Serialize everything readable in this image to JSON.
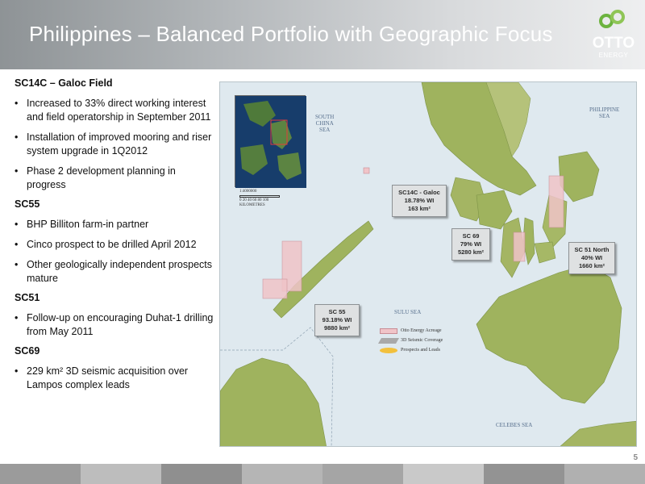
{
  "header": {
    "title": "Philippines – Balanced Portfolio with Geographic Focus",
    "logo_text": "OTTO",
    "logo_sub": "ENERGY",
    "logo_color": "#6cb33f"
  },
  "sections": [
    {
      "heading": "SC14C – Galoc Field",
      "bullets": [
        "Increased to 33% direct working interest and field operatorship in September 2011",
        "Installation of improved mooring and riser system upgrade in 1Q2012",
        "Phase 2 development planning in progress"
      ]
    },
    {
      "heading": "SC55",
      "bullets": [
        "BHP Billiton farm-in partner",
        "Cinco prospect to be drilled April 2012",
        "Other geologically independent prospects mature"
      ]
    },
    {
      "heading": "SC51",
      "bullets": [
        "Follow-up on encouraging Duhat-1 drilling from May 2011"
      ]
    },
    {
      "heading": "SC69",
      "bullets": [
        "229 km² 3D seismic acquisition over Lampos complex leads"
      ]
    }
  ],
  "map": {
    "seas": {
      "south_china_1": "SOUTH",
      "south_china_2": "CHINA",
      "south_china_3": "SEA",
      "philippine_1": "PHILIPPINE",
      "philippine_2": "SEA",
      "sulu": "SULU SEA",
      "celebes": "CELEBES SEA"
    },
    "callouts": {
      "sc14c": {
        "line1": "SC14C - Galoc",
        "line2": "18.78% WI",
        "line3": "163 km²"
      },
      "sc69": {
        "line1": "SC 69",
        "line2": "79% WI",
        "line3": "5280 km²"
      },
      "sc51": {
        "line1": "SC 51 North",
        "line2": "40% WI",
        "line3": "1660 km²"
      },
      "sc55": {
        "line1": "SC 55",
        "line2": "93.18% WI",
        "line3": "9880 km²"
      }
    },
    "legend": {
      "acreage": "Otto Energy Acreage",
      "seismic": "3D Seismic Coverage",
      "prospects": "Prospects and Leads"
    },
    "scale": {
      "ratio": "1:4000000",
      "ticks": "0   20   40   60   80  100",
      "unit": "KILOMETRES"
    },
    "colors": {
      "sea": "#dfe9ef",
      "land": "#9fb35e",
      "acreage": "#f0c4c8"
    }
  },
  "footer": {
    "page_number": "5",
    "bar_colors": [
      "#9b9b9b",
      "#bdbdbd",
      "#8f8f8f",
      "#b5b5b5",
      "#a5a5a5",
      "#c9c9c9",
      "#939393",
      "#b0b0b0"
    ]
  }
}
